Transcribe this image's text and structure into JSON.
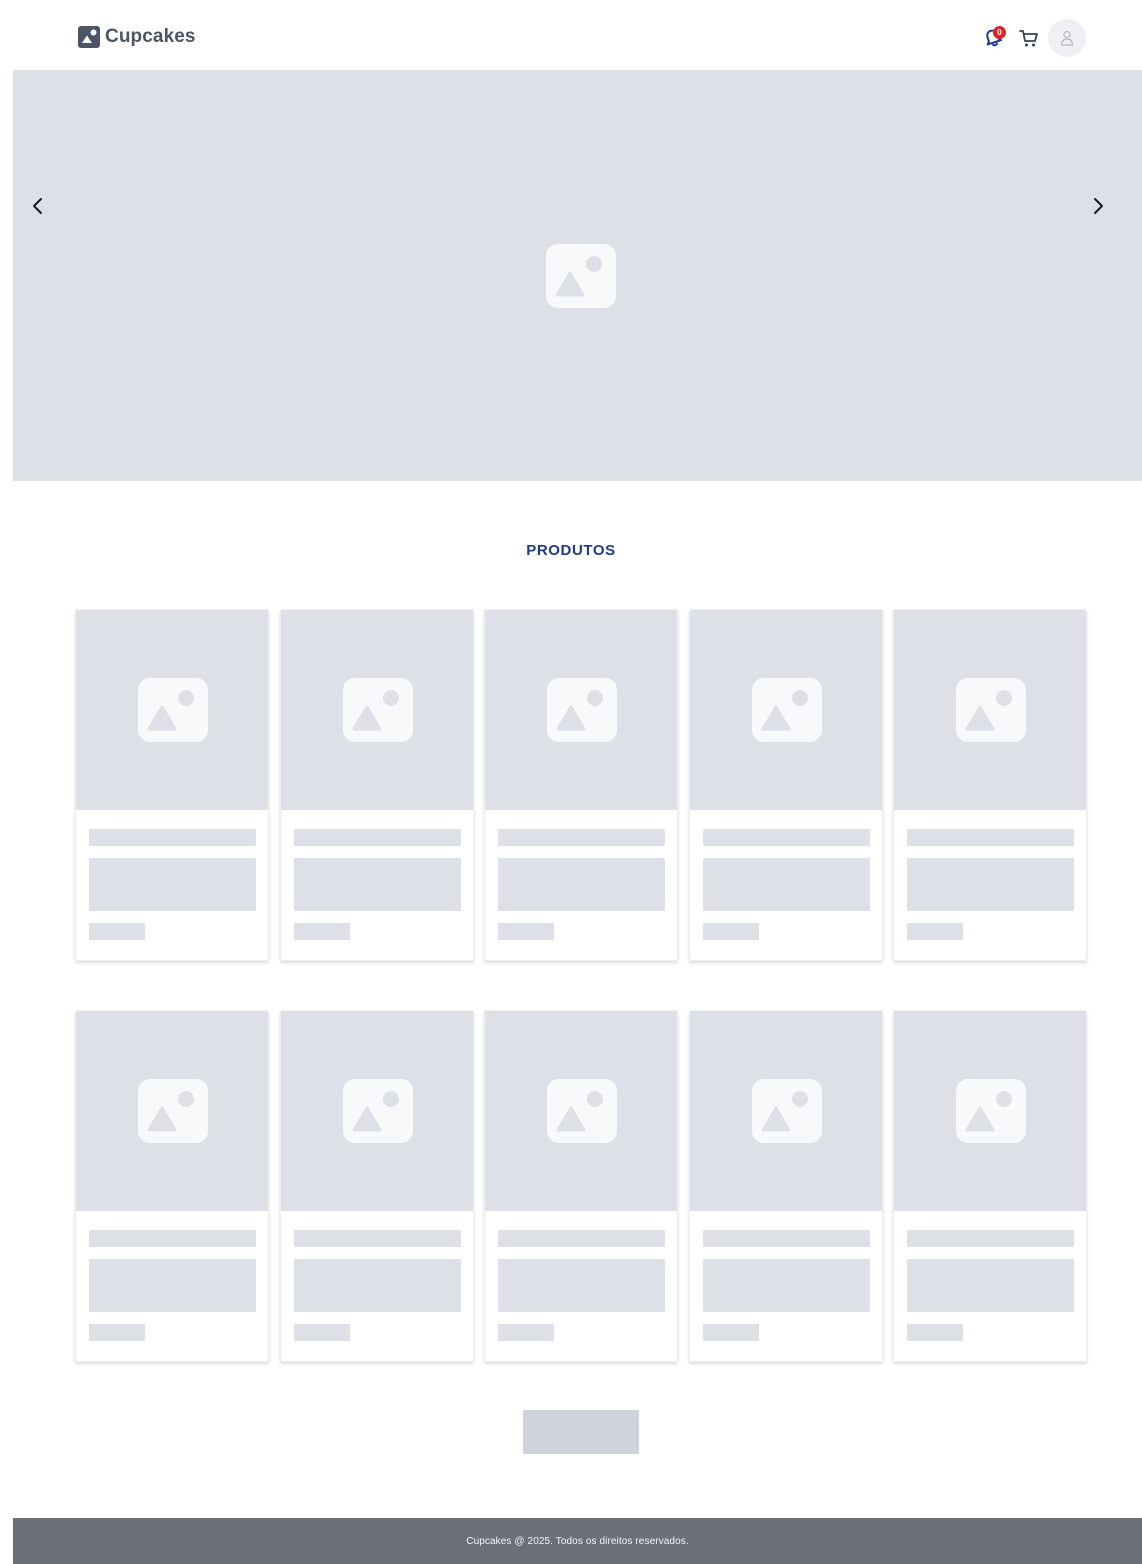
{
  "header": {
    "brand": "Cupcakes",
    "notifications_count": "0"
  },
  "hero": {
    "prev_icon": "chevron-left-icon",
    "next_icon": "chevron-right-icon"
  },
  "products": {
    "title": "PRODUTOS",
    "card_count_per_row": 5,
    "row_count": 2,
    "state": "loading-skeleton"
  },
  "footer": {
    "text": "Cupcakes @ 2025. Todos os direitos reservados."
  },
  "colors": {
    "placeholder": "#dde1e7",
    "title": "#1e3a8a",
    "footer_bg": "#6b7079",
    "badge": "#dc2626",
    "button_skeleton": "#cfd4dc"
  }
}
